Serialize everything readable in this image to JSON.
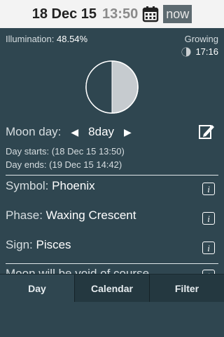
{
  "header": {
    "date": "18 Dec 15",
    "time": "13:50",
    "now_label": "now"
  },
  "illumination": {
    "label": "Illumination:",
    "value": "48.54%"
  },
  "phase_trend": {
    "status": "Growing",
    "time": "17:16"
  },
  "moon_day": {
    "label": "Moon day:",
    "value": "8day",
    "starts": "Day starts: (18 Dec 15 13:50)",
    "ends": "Day ends: (19 Dec 15 14:42)"
  },
  "details": [
    {
      "label": "Symbol:",
      "value": "Phoenix"
    },
    {
      "label": "Phase:",
      "value": "Waxing Crescent"
    },
    {
      "label": "Sign:",
      "value": "Pisces"
    },
    {
      "label": "Moon will be void of course",
      "value": ""
    }
  ],
  "tabs": [
    {
      "label": "Day"
    },
    {
      "label": "Calendar"
    },
    {
      "label": "Filter"
    }
  ],
  "colors": {
    "background": "#2f4650",
    "topbar": "#f3f3f3",
    "tab_active": "#2f4650",
    "tab_inactive": "#243840"
  }
}
